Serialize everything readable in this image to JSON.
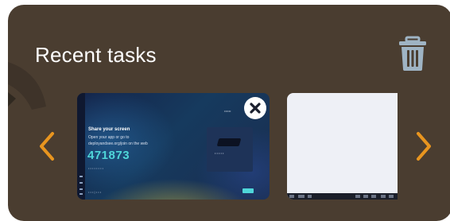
{
  "header": {
    "title": "Recent tasks",
    "clear_icon": "trash-icon"
  },
  "navigation": {
    "prev_icon": "chevron-left-icon",
    "next_icon": "chevron-right-icon",
    "arrow_color": "#e8951f"
  },
  "tasks": [
    {
      "close_icon": "close-icon",
      "heading": "Share your screen",
      "line1": "Open your app or go to",
      "line2": "deployandsee.org/join on the web",
      "code": "471873",
      "code_color": "#4fd6d9"
    },
    {
      "preview": "blank"
    }
  ],
  "colors": {
    "panel_background": "#4a3d30",
    "title_text": "#ffffff",
    "trash_icon": "#9fb4c4"
  }
}
